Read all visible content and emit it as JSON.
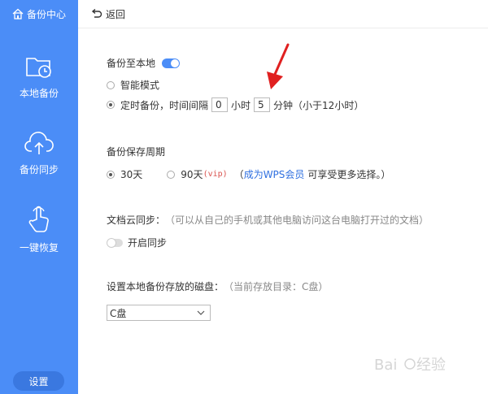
{
  "sidebar": {
    "brand": "备份中心",
    "items": [
      {
        "label": "本地备份",
        "icon": "folder-clock-icon"
      },
      {
        "label": "备份同步",
        "icon": "cloud-upload-icon"
      },
      {
        "label": "一键恢复",
        "icon": "hand-tap-icon"
      }
    ],
    "settings_label": "设置"
  },
  "topbar": {
    "back_label": "返回"
  },
  "local_backup": {
    "title": "备份至本地",
    "toggle_on": true,
    "mode_smart": "智能模式",
    "mode_timed_prefix": "定时备份，时间间隔",
    "hours_value": "0",
    "hours_unit": "小时",
    "minutes_value": "5",
    "minutes_unit": "分钟",
    "limit_note": "（小于12小时）"
  },
  "retention": {
    "title": "备份保存周期",
    "opt_30": "30天",
    "opt_90": "90天",
    "vip_tag": "(vip)",
    "paren_open": "（",
    "link": "成为WPS会员",
    "after_link": "可享受更多选择。）"
  },
  "cloud_sync": {
    "title": "文档云同步：",
    "desc": "（可以从自己的手机或其他电脑访问这台电脑打开过的文档）",
    "toggle_label": "开启同步"
  },
  "disk": {
    "title": "设置本地备份存放的磁盘：",
    "current": "（当前存放目录：C盘）",
    "select_value": "C盘"
  },
  "colors": {
    "sidebar": "#4b8df7",
    "link": "#2e6fe0",
    "annotation_arrow": "#e02020"
  }
}
